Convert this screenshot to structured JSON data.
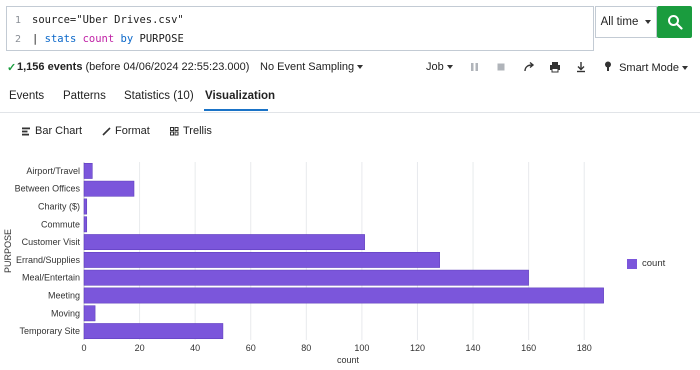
{
  "search": {
    "line_numbers": [
      "1",
      "2"
    ],
    "line1": "source=\"Uber Drives.csv\"",
    "line2_pipe": "| ",
    "line2_cmd": "stats",
    "line2_fn": "count",
    "line2_by": "by",
    "line2_field": "PURPOSE"
  },
  "time_picker": {
    "label": "All time"
  },
  "status": {
    "events_count": "1,156 events",
    "events_suffix": "(before 04/06/2024 22:55:23.000)",
    "sampling": "No Event Sampling",
    "job": "Job",
    "smart_mode": "Smart Mode"
  },
  "tabs": [
    {
      "label": "Events"
    },
    {
      "label": "Patterns"
    },
    {
      "label": "Statistics (10)"
    },
    {
      "label": "Visualization"
    }
  ],
  "viz_toolbar": {
    "bar_chart": "Bar Chart",
    "format": "Format",
    "trellis": "Trellis"
  },
  "legend": {
    "label": "count"
  },
  "colors": {
    "bar": "#7b56db",
    "accent": "#1a73c7",
    "search_button": "#1a9c3e"
  },
  "chart_data": {
    "type": "bar",
    "orientation": "horizontal",
    "categories": [
      "Airport/Travel",
      "Between Offices",
      "Charity ($)",
      "Commute",
      "Customer Visit",
      "Errand/Supplies",
      "Meal/Entertain",
      "Meeting",
      "Moving",
      "Temporary Site"
    ],
    "series": [
      {
        "name": "count",
        "values": [
          3,
          18,
          1,
          1,
          101,
          128,
          160,
          187,
          4,
          50
        ]
      }
    ],
    "xlabel": "count",
    "ylabel": "PURPOSE",
    "xlim": [
      0,
      190
    ],
    "xticks": [
      "0",
      "20",
      "40",
      "60",
      "80",
      "100",
      "120",
      "140",
      "160",
      "180"
    ],
    "grid": true,
    "legend": "right"
  }
}
